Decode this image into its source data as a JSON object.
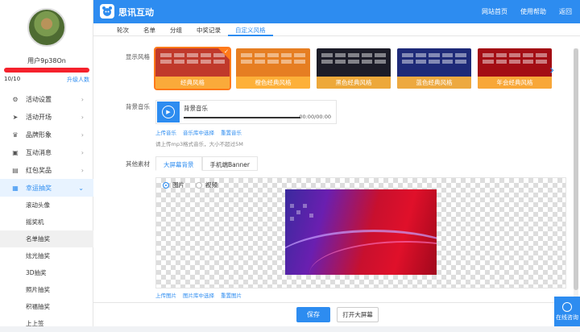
{
  "header": {
    "brand": "思讯互动",
    "nav": [
      "网站首页",
      "使用帮助",
      "返回"
    ]
  },
  "sidebar": {
    "username": "用户9p38On",
    "quota": "10/10",
    "quota_fraction": 1.0,
    "upgrade": "升级人数",
    "menu": [
      {
        "label": "活动设置",
        "icon": "gear-icon"
      },
      {
        "label": "活动开场",
        "icon": "send-icon"
      },
      {
        "label": "品牌形象",
        "icon": "brand-icon"
      },
      {
        "label": "互动消息",
        "icon": "message-icon"
      },
      {
        "label": "红包奖品",
        "icon": "gift-icon"
      },
      {
        "label": "幸运抽奖",
        "icon": "lottery-icon"
      }
    ],
    "submenu": [
      "滚动头像",
      "摇奖机",
      "名单抽奖",
      "炫光抽奖",
      "3D抽奖",
      "照片抽奖",
      "积福抽奖",
      "上上签"
    ]
  },
  "tabs": [
    "轮次",
    "名单",
    "分组",
    "中奖记录",
    "自定义风格"
  ],
  "style": {
    "label": "显示风格",
    "themes": [
      {
        "caption": "经典风格",
        "bg": "#c0392b"
      },
      {
        "caption": "橙色经典风格",
        "bg": "#e67e22"
      },
      {
        "caption": "黑色经典风格",
        "bg": "#1c1c28"
      },
      {
        "caption": "蓝色经典风格",
        "bg": "#1e2a78"
      },
      {
        "caption": "年会经典风格",
        "bg": "#a30d14"
      }
    ]
  },
  "music": {
    "label": "背景音乐",
    "title": "背景音乐",
    "time": "00:00/00:00",
    "links": [
      "上传音乐",
      "音乐库中选择",
      "重置音乐"
    ],
    "hint": "请上传mp3格式音乐，大小不超过5M"
  },
  "materials": {
    "label": "其他素材",
    "tabs": [
      "大屏幕背景",
      "手机端Banner"
    ],
    "radios": [
      "图片",
      "视频"
    ],
    "links": [
      "上传图片",
      "图片库中选择",
      "重置图片"
    ]
  },
  "footer": {
    "save": "保存",
    "open": "打开大屏幕"
  },
  "online": "在线咨询"
}
